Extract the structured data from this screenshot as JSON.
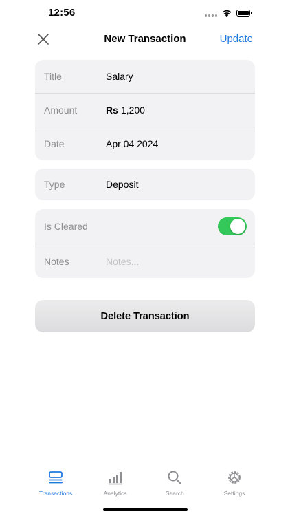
{
  "status_bar": {
    "time": "12:56"
  },
  "nav": {
    "title": "New Transaction",
    "update_label": "Update",
    "close_icon": "close-icon"
  },
  "details_group": {
    "title_label": "Title",
    "title_value": "Salary",
    "amount_label": "Amount",
    "amount_currency": "Rs",
    "amount_value": "1,200",
    "date_label": "Date",
    "date_value": "Apr 04 2024"
  },
  "type_group": {
    "type_label": "Type",
    "type_value": "Deposit"
  },
  "extra_group": {
    "cleared_label": "Is Cleared",
    "cleared_on": true,
    "notes_label": "Notes",
    "notes_placeholder": "Notes..."
  },
  "delete_label": "Delete Transaction",
  "tabs": [
    {
      "label": "Transactions",
      "icon": "transactions-icon",
      "active": true
    },
    {
      "label": "Analytics",
      "icon": "analytics-icon",
      "active": false
    },
    {
      "label": "Search",
      "icon": "search-icon",
      "active": false
    },
    {
      "label": "Settings",
      "icon": "settings-icon",
      "active": false
    }
  ],
  "colors": {
    "accent": "#1f7ae0",
    "toggle_on": "#34c759",
    "group_bg": "#f2f2f4",
    "label_gray": "#8e8e93"
  }
}
